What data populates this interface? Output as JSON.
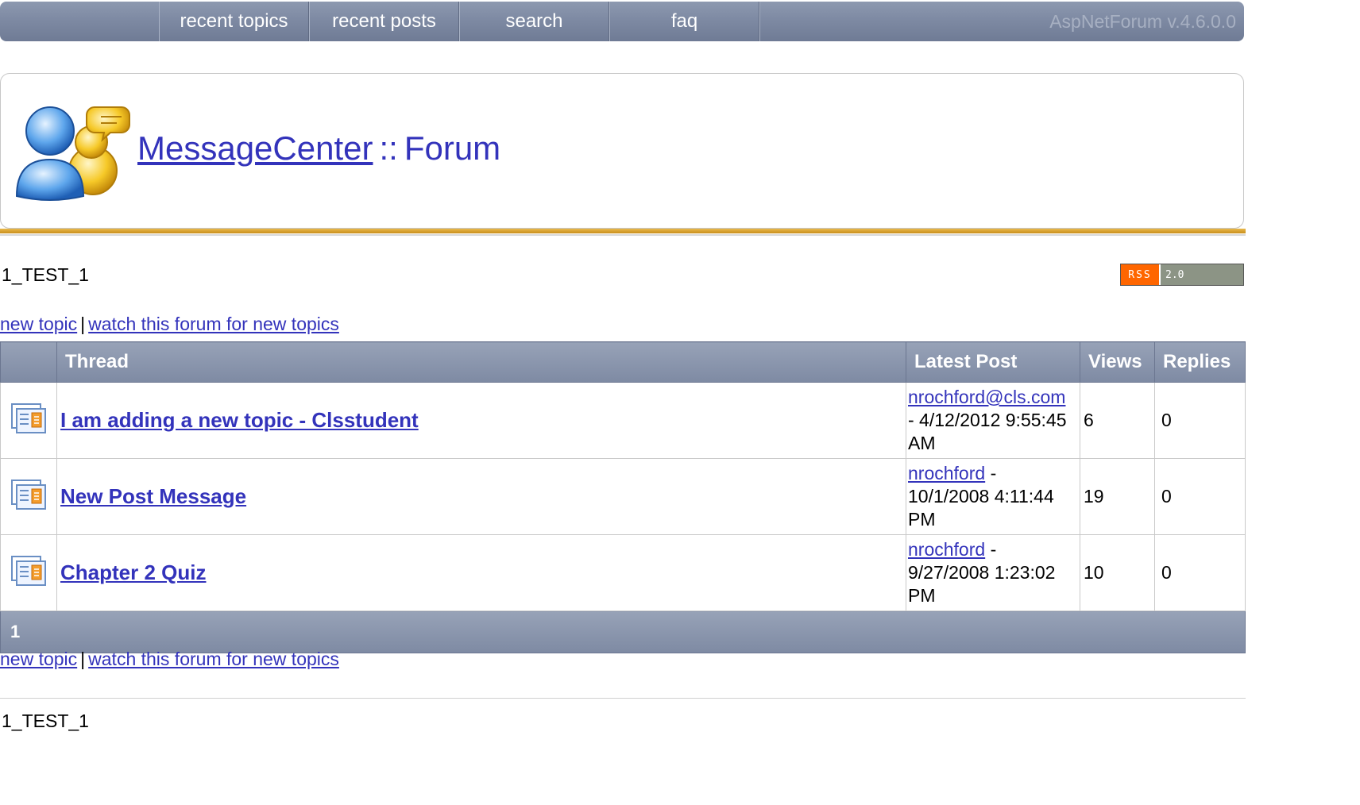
{
  "nav": {
    "items": [
      "recent topics",
      "recent posts",
      "search",
      "faq"
    ],
    "version": "AspNetForum v.4.6.0.0"
  },
  "header": {
    "site_link": "MessageCenter",
    "separator": "::",
    "section": "Forum"
  },
  "forum": {
    "name": "1_TEST_1"
  },
  "rss": {
    "label": "RSS",
    "version": "2.0"
  },
  "actions": {
    "new_topic": "new topic",
    "pipe": "|",
    "watch": "watch this forum for new topics"
  },
  "table": {
    "headers": {
      "thread": "Thread",
      "latest": "Latest Post",
      "views": "Views",
      "replies": "Replies"
    },
    "rows": [
      {
        "title": "I am adding a new topic - Clsstudent",
        "author": "nrochford@cls.com",
        "date": "- 4/12/2012 9:55:45 AM",
        "views": "6",
        "replies": "0"
      },
      {
        "title": "New Post Message",
        "author": "nrochford",
        "date": "- 10/1/2008 4:11:44 PM",
        "views": "19",
        "replies": "0"
      },
      {
        "title": "Chapter 2 Quiz",
        "author": "nrochford",
        "date": "- 9/27/2008 1:23:02 PM",
        "views": "10",
        "replies": "0"
      }
    ],
    "pager": "1"
  },
  "colors": {
    "link": "#3333bb",
    "nav": "#7e8aa3",
    "gold": "#e0a93a",
    "rss_orange": "#ff6600"
  }
}
